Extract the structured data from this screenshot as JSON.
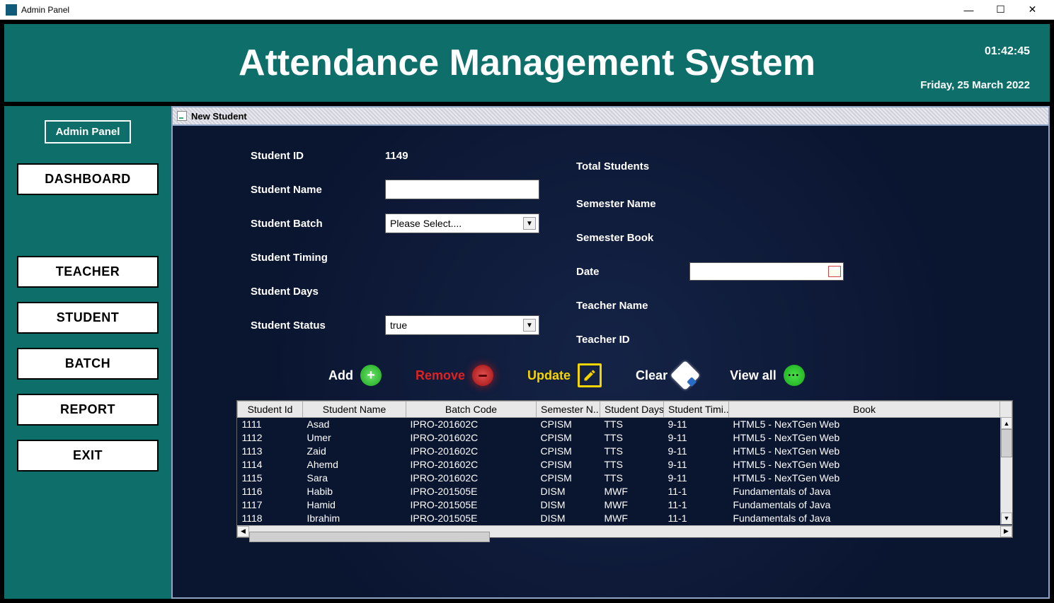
{
  "window": {
    "title": "Admin Panel",
    "minimize": "—",
    "maximize": "☐",
    "close": "✕"
  },
  "banner": {
    "title": "Attendance Management System",
    "time": "01:42:45",
    "date": "Friday, 25 March 2022"
  },
  "sidebar": {
    "panel_label": "Admin Panel",
    "items": [
      {
        "label": "DASHBOARD"
      },
      {
        "label": "TEACHER"
      },
      {
        "label": "STUDENT"
      },
      {
        "label": "BATCH"
      },
      {
        "label": "REPORT"
      },
      {
        "label": "EXIT"
      }
    ]
  },
  "inner": {
    "title": "New Student"
  },
  "form": {
    "left": {
      "student_id_label": "Student ID",
      "student_id_value": "1149",
      "student_name_label": "Student Name",
      "student_name_value": "",
      "student_batch_label": "Student Batch",
      "student_batch_value": "Please Select....",
      "student_timing_label": "Student Timing",
      "student_days_label": "Student Days",
      "student_status_label": "Student Status",
      "student_status_value": "true"
    },
    "right": {
      "total_students_label": "Total Students",
      "semester_name_label": "Semester Name",
      "semester_book_label": "Semester Book",
      "date_label": "Date",
      "date_value": "",
      "teacher_name_label": "Teacher Name",
      "teacher_id_label": "Teacher ID"
    }
  },
  "actions": {
    "add": "Add",
    "remove": "Remove",
    "update": "Update",
    "clear": "Clear",
    "viewall": "View all"
  },
  "table": {
    "columns": [
      "Student Id",
      "Student Name",
      "Batch Code",
      "Semester N...",
      "Student Days",
      "Student Timi...",
      "Book"
    ],
    "rows": [
      [
        "1111",
        "Asad",
        "IPRO-201602C",
        "CPISM",
        "TTS",
        "9-11",
        "HTML5 - NexTGen Web"
      ],
      [
        "1112",
        "Umer",
        "IPRO-201602C",
        "CPISM",
        "TTS",
        "9-11",
        "HTML5 - NexTGen Web"
      ],
      [
        "1113",
        "Zaid",
        "IPRO-201602C",
        "CPISM",
        "TTS",
        "9-11",
        "HTML5 - NexTGen Web"
      ],
      [
        "1114",
        "Ahemd",
        "IPRO-201602C",
        "CPISM",
        "TTS",
        "9-11",
        "HTML5 - NexTGen Web"
      ],
      [
        "1115",
        "Sara",
        "IPRO-201602C",
        "CPISM",
        "TTS",
        "9-11",
        "HTML5 - NexTGen Web"
      ],
      [
        "1116",
        "Habib",
        "IPRO-201505E",
        "DISM",
        "MWF",
        "11-1",
        "Fundamentals of Java"
      ],
      [
        "1117",
        "Hamid",
        "IPRO-201505E",
        "DISM",
        "MWF",
        "11-1",
        "Fundamentals of Java"
      ],
      [
        "1118",
        "Ibrahim",
        "IPRO-201505E",
        "DISM",
        "MWF",
        "11-1",
        "Fundamentals of Java"
      ]
    ]
  }
}
